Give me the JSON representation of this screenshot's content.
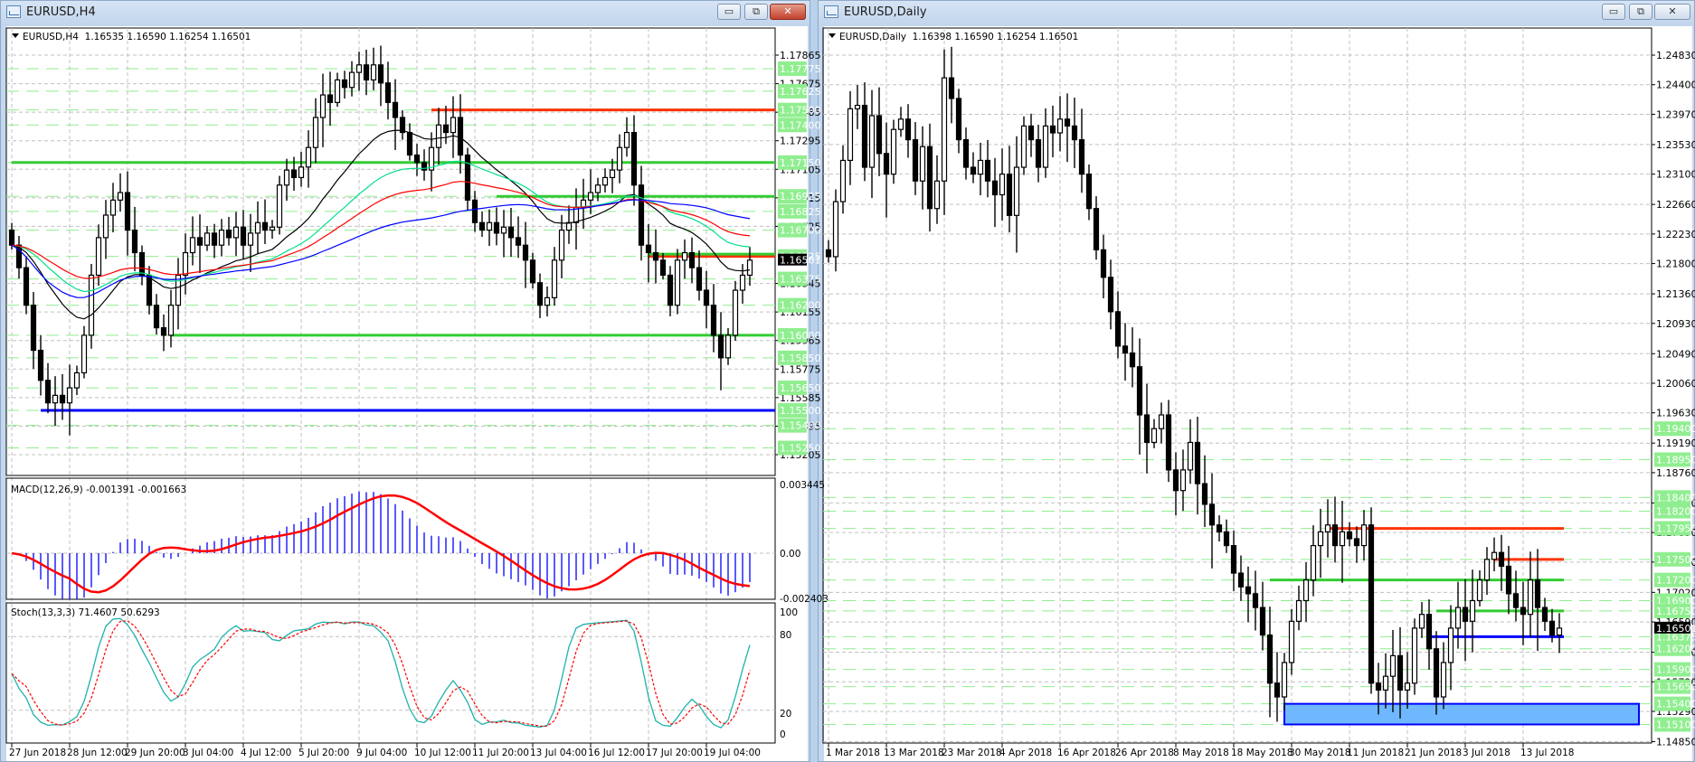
{
  "h4": {
    "title": "EURUSD,H4",
    "header": "EURUSD,H4  1.16535 1.16590 1.16254 1.16501",
    "price_labels": [
      "1.17865",
      "1.17675",
      "1.17485",
      "1.17295",
      "1.17105",
      "1.16915",
      "1.16725",
      "1.16345",
      "1.16155",
      "1.15965",
      "1.15775",
      "1.15585",
      "1.15395",
      "1.15205"
    ],
    "level_labels": [
      "1.17775",
      "1.17625",
      "1.17500",
      "1.17400",
      "1.17150",
      "1.16925",
      "1.16825",
      "1.16700",
      "1.16525",
      "1.16375",
      "1.16200",
      "1.16000",
      "1.15850",
      "1.15650",
      "1.15500",
      "1.15400",
      "1.15250"
    ],
    "current_price": "1.16501",
    "levels": [
      {
        "price": 1.175,
        "color": "#ff3300",
        "from_bar": 58
      },
      {
        "price": 1.1715,
        "color": "#33cc33",
        "from_bar": 0
      },
      {
        "price": 1.16925,
        "color": "#33cc33",
        "from_bar": 67
      },
      {
        "price": 1.16525,
        "color": "#ff3300",
        "from_bar": 88
      },
      {
        "price": 1.1654,
        "color": "#33cc33",
        "from_bar": 88
      },
      {
        "price": 1.16,
        "color": "#33cc33",
        "from_bar": 22
      },
      {
        "price": 1.155,
        "color": "#0000ff",
        "from_bar": 4
      }
    ],
    "closes": [
      1.166,
      1.1645,
      1.162,
      1.159,
      1.157,
      1.1555,
      1.156,
      1.1555,
      1.1565,
      1.1575,
      1.16,
      1.164,
      1.1665,
      1.168,
      1.169,
      1.1695,
      1.167,
      1.1655,
      1.164,
      1.162,
      1.1605,
      1.16,
      1.162,
      1.164,
      1.1655,
      1.1665,
      1.166,
      1.1668,
      1.166,
      1.167,
      1.1665,
      1.1672,
      1.166,
      1.1668,
      1.1675,
      1.167,
      1.1672,
      1.17,
      1.171,
      1.1705,
      1.1712,
      1.1725,
      1.1745,
      1.176,
      1.1755,
      1.177,
      1.1765,
      1.1775,
      1.178,
      1.177,
      1.178,
      1.1768,
      1.1755,
      1.1745,
      1.1735,
      1.172,
      1.1715,
      1.171,
      1.1725,
      1.174,
      1.1735,
      1.1745,
      1.172,
      1.169,
      1.1675,
      1.167,
      1.1675,
      1.1668,
      1.1672,
      1.1665,
      1.166,
      1.165,
      1.1635,
      1.162,
      1.1625,
      1.165,
      1.167,
      1.1675,
      1.1685,
      1.169,
      1.1695,
      1.17,
      1.1705,
      1.171,
      1.1725,
      1.1735,
      1.17,
      1.166,
      1.1655,
      1.165,
      1.164,
      1.162,
      1.165,
      1.1655,
      1.1645,
      1.163,
      1.162,
      1.16,
      1.1585,
      1.16,
      1.163,
      1.164,
      1.165
    ],
    "macd": {
      "label": "MACD(12,26,9) -0.001391 -0.001663",
      "axis": [
        "0.003445",
        "0.00",
        "-0.002403"
      ]
    },
    "stoch": {
      "label": "Stoch(13,3,3) 71.4607 50.6293",
      "axis": [
        "100",
        "80",
        "20",
        "0"
      ]
    },
    "time_labels": [
      "27 Jun 2018",
      "28 Jun 12:00",
      "29 Jun 20:00",
      "3 Jul 04:00",
      "4 Jul 12:00",
      "5 Jul 20:00",
      "9 Jul 04:00",
      "10 Jul 12:00",
      "11 Jul 20:00",
      "13 Jul 04:00",
      "16 Jul 12:00",
      "17 Jul 20:00",
      "19 Jul 04:00"
    ],
    "colors": {
      "ma_fast": "#000000",
      "ma_mid": "#00e08a",
      "ma_slow": "#ff0000",
      "ma_long": "#0000ff",
      "macd_hist": "#0000ff",
      "macd_signal": "#ff0000",
      "stoch_main": "#20b2aa",
      "stoch_signal": "#ff0000"
    }
  },
  "daily": {
    "title": "EURUSD,Daily",
    "header": "EURUSD,Daily  1.16398 1.16590 1.16254 1.16501",
    "price_labels": [
      "1.24830",
      "1.24400",
      "1.23970",
      "1.23530",
      "1.23100",
      "1.22660",
      "1.22230",
      "1.21800",
      "1.21360",
      "1.20930",
      "1.20490",
      "1.20060",
      "1.19630",
      "1.19190",
      "1.18760",
      "1.18320",
      "1.17890",
      "1.17460",
      "1.17020",
      "1.16590",
      "1.16150",
      "1.15720",
      "1.15290",
      "1.14850"
    ],
    "level_labels": [
      "1.19400",
      "1.18950",
      "1.18400",
      "1.18200",
      "1.17950",
      "1.17500",
      "1.17200",
      "1.16900",
      "1.16750",
      "1.16375",
      "1.16200",
      "1.15900",
      "1.15650",
      "1.15400",
      "1.15100"
    ],
    "current_price": "1.16501",
    "levels": [
      {
        "price": 1.1795,
        "color": "#ff3300",
        "from_bar": 69
      },
      {
        "price": 1.175,
        "color": "#ff3300",
        "from_bar": 92
      },
      {
        "price": 1.172,
        "color": "#33cc33",
        "from_bar": 61
      },
      {
        "price": 1.1675,
        "color": "#33cc33",
        "from_bar": 84
      },
      {
        "price": 1.16375,
        "color": "#0000ff",
        "from_bar": 83
      }
    ],
    "zone": {
      "top": 1.154,
      "bottom": 1.151,
      "from_bar": 63,
      "color": "#6fb8ff"
    },
    "closes": [
      1.219,
      1.227,
      1.233,
      1.2405,
      1.241,
      1.232,
      1.2395,
      1.234,
      1.231,
      1.2375,
      1.239,
      1.236,
      1.23,
      1.235,
      1.226,
      1.23,
      1.245,
      1.242,
      1.236,
      1.232,
      1.231,
      1.233,
      1.23,
      1.228,
      1.231,
      1.225,
      1.232,
      1.238,
      1.236,
      1.232,
      1.238,
      1.237,
      1.239,
      1.238,
      1.236,
      1.231,
      1.226,
      1.22,
      1.216,
      1.211,
      1.206,
      1.205,
      1.203,
      1.196,
      1.192,
      1.194,
      1.196,
      1.188,
      1.185,
      1.188,
      1.192,
      1.186,
      1.183,
      1.18,
      1.179,
      1.177,
      1.173,
      1.171,
      1.17,
      1.168,
      1.164,
      1.157,
      1.155,
      1.16,
      1.166,
      1.169,
      1.172,
      1.177,
      1.179,
      1.18,
      1.177,
      1.179,
      1.178,
      1.177,
      1.18,
      1.157,
      1.156,
      1.158,
      1.161,
      1.156,
      1.157,
      1.165,
      1.167,
      1.162,
      1.155,
      1.16,
      1.165,
      1.168,
      1.166,
      1.169,
      1.172,
      1.175,
      1.176,
      1.174,
      1.17,
      1.168,
      1.167,
      1.172,
      1.168,
      1.166,
      1.164,
      1.165
    ],
    "time_labels": [
      "1 Mar 2018",
      "13 Mar 2018",
      "23 Mar 2018",
      "4 Apr 2018",
      "16 Apr 2018",
      "26 Apr 2018",
      "8 May 2018",
      "18 May 2018",
      "30 May 2018",
      "11 Jun 2018",
      "21 Jun 2018",
      "3 Jul 2018",
      "13 Jul 2018"
    ]
  },
  "window_buttons": {
    "minimize": "▭",
    "restore": "⧉",
    "close": "✕"
  }
}
